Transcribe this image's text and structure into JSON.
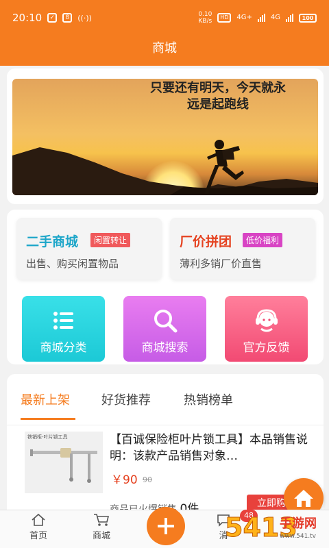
{
  "status_bar": {
    "time": "20:10",
    "speed": "0.10",
    "speed_unit": "KB/s",
    "hd_label": "HD",
    "network_1": "4G+",
    "network_2": "4G",
    "battery": "100"
  },
  "header": {
    "title": "商城"
  },
  "banner": {
    "line1": "只要还有明天，今天就永",
    "line2": "远是起跑线"
  },
  "features": [
    {
      "title": "二手商城",
      "tag": "闲置转让",
      "subtitle": "出售、购买闲置物品",
      "title_color": "#1da6c9",
      "tag_color": "#f0595b"
    },
    {
      "title": "厂价拼团",
      "tag": "低价福利",
      "subtitle": "薄利多销厂价直售",
      "title_color": "#e5411f",
      "tag_color": "#d844c4"
    }
  ],
  "quick_actions": [
    {
      "label": "商城分类",
      "icon": "list-icon",
      "color_from": "#39e0e8",
      "color_to": "#1cc9d6"
    },
    {
      "label": "商城搜索",
      "icon": "search-icon",
      "color_from": "#e97df0",
      "color_to": "#c65ce6"
    },
    {
      "label": "官方反馈",
      "icon": "headset-icon",
      "color_from": "#ff7f9b",
      "color_to": "#f24a73"
    }
  ],
  "tabs": [
    {
      "label": "最新上架",
      "active": true
    },
    {
      "label": "好货推荐",
      "active": false
    },
    {
      "label": "热销榜单",
      "active": false
    }
  ],
  "product": {
    "thumb_caption": "铁销柜-叶片锁工具",
    "title": "【百诚保险柜叶片锁工具】本品销售说明：该款产品销售对象…",
    "price": "￥90",
    "original_price": "90",
    "sold_label": "商品已火爆销售",
    "sold_count": "0件",
    "buy_label": "立即购"
  },
  "bottom_nav": [
    {
      "label": "首页",
      "icon": "home-outline-icon"
    },
    {
      "label": "商城",
      "icon": "cart-icon"
    },
    {
      "label": "消",
      "icon": "message-icon"
    }
  ],
  "message_badge": "48",
  "watermark": {
    "number": "5413",
    "text": "手游网",
    "url": "www.541.tv"
  },
  "colors": {
    "accent": "#f57c1f",
    "price": "#e5411f"
  }
}
